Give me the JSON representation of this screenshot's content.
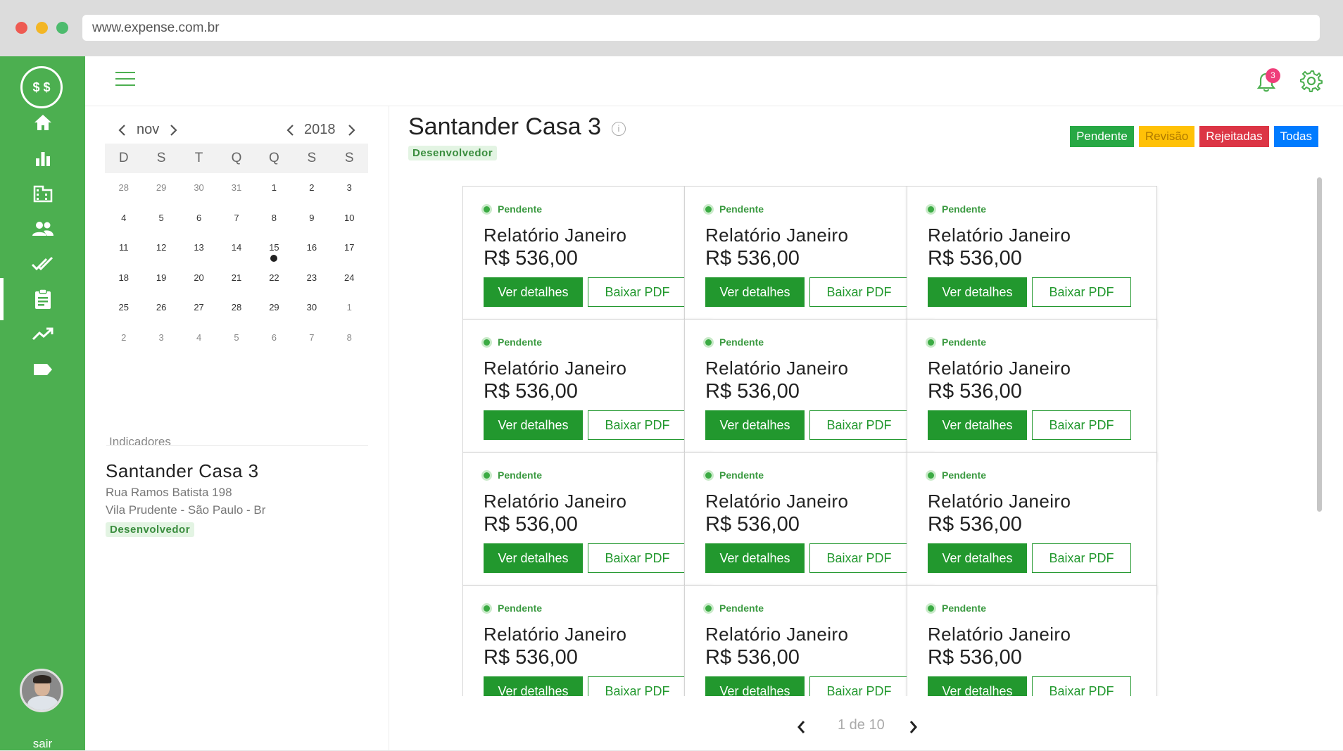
{
  "browser": {
    "url": "www.expense.com.br"
  },
  "sidebar": {
    "logo_text": "$ $",
    "items": [
      {
        "icon": "home-icon"
      },
      {
        "icon": "bar-chart-icon"
      },
      {
        "icon": "building-icon"
      },
      {
        "icon": "people-icon"
      },
      {
        "icon": "double-check-icon"
      },
      {
        "icon": "clipboard-icon",
        "active": true
      },
      {
        "icon": "trending-up-icon"
      },
      {
        "icon": "tag-icon"
      }
    ],
    "logout_label": "sair"
  },
  "header": {
    "notification_count": "3"
  },
  "calendar": {
    "month": "nov",
    "year": "2018",
    "weekdays": [
      "D",
      "S",
      "T",
      "Q",
      "Q",
      "S",
      "S"
    ],
    "days": [
      "28",
      "29",
      "30",
      "31",
      "1",
      "2",
      "3",
      "4",
      "5",
      "6",
      "7",
      "8",
      "9",
      "10",
      "11",
      "12",
      "13",
      "14",
      "15",
      "16",
      "17",
      "18",
      "19",
      "20",
      "21",
      "22",
      "23",
      "24",
      "25",
      "26",
      "27",
      "28",
      "29",
      "30",
      "1",
      "2",
      "3",
      "4",
      "5",
      "6",
      "7",
      "8"
    ],
    "muted_indices": [
      0,
      1,
      2,
      3,
      34,
      35,
      36,
      37,
      38,
      39,
      40,
      41
    ],
    "marked_index": 18
  },
  "indicators": {
    "label": "Indicadores",
    "title": "Santander Casa 3",
    "address_line1": "Rua Ramos Batista 198",
    "address_line2": "Vila Prudente - São Paulo - Br",
    "tag": "Desenvolvedor"
  },
  "main": {
    "title": "Santander Casa 3",
    "info_glyph": "i",
    "tag": "Desenvolvedor",
    "filters": [
      "Pendente",
      "Revisão",
      "Rejeitadas",
      "Todas"
    ]
  },
  "cards": [
    {
      "status": "Pendente",
      "title": "Relatório Janeiro",
      "value": "R$ 536,00"
    },
    {
      "status": "Pendente",
      "title": "Relatório Janeiro",
      "value": "R$ 536,00"
    },
    {
      "status": "Pendente",
      "title": "Relatório Janeiro",
      "value": "R$ 536,00"
    },
    {
      "status": "Pendente",
      "title": "Relatório Janeiro",
      "value": "R$ 536,00"
    },
    {
      "status": "Pendente",
      "title": "Relatório Janeiro",
      "value": "R$ 536,00"
    },
    {
      "status": "Pendente",
      "title": "Relatório Janeiro",
      "value": "R$ 536,00"
    },
    {
      "status": "Pendente",
      "title": "Relatório Janeiro",
      "value": "R$ 536,00"
    },
    {
      "status": "Pendente",
      "title": "Relatório Janeiro",
      "value": "R$ 536,00"
    },
    {
      "status": "Pendente",
      "title": "Relatório Janeiro",
      "value": "R$ 536,00"
    },
    {
      "status": "Pendente",
      "title": "Relatório Janeiro",
      "value": "R$ 536,00"
    },
    {
      "status": "Pendente",
      "title": "Relatório Janeiro",
      "value": "R$ 536,00"
    },
    {
      "status": "Pendente",
      "title": "Relatório Janeiro",
      "value": "R$ 536,00"
    }
  ],
  "card_buttons": {
    "details": "Ver detalhes",
    "pdf": "Baixar PDF"
  },
  "pagination": {
    "text": "1 de 10"
  },
  "colors": {
    "brand_green": "#4caf50",
    "button_green": "#22982e",
    "pending": "#27a844",
    "review": "#ffc107",
    "rejected": "#dc3545",
    "all": "#007bff"
  }
}
